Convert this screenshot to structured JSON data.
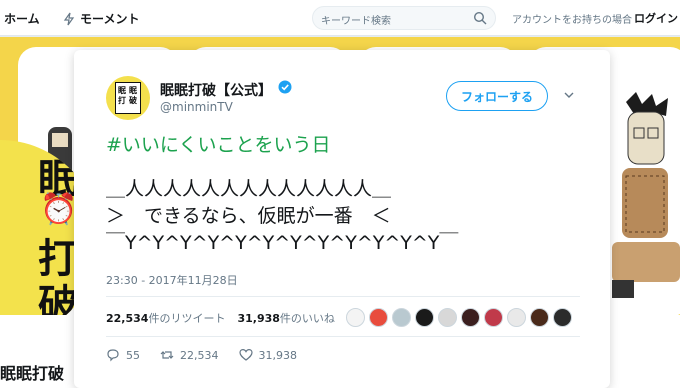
{
  "nav": {
    "home": "ホーム",
    "moments": "モーメント",
    "search_placeholder": "キーワード検索",
    "account_prompt": "アカウントをお持ちの場合",
    "login": "ログイン"
  },
  "background": {
    "banner_color": "#f4d54a",
    "avatar_chars": [
      "眠",
      "⏰",
      "打",
      "破"
    ],
    "profile_name": "眠眠打破【公"
  },
  "tweet": {
    "display_name": "眠眠打破【公式】",
    "screen_name": "@minminTV",
    "verified": true,
    "follow_label": "フォローする",
    "hashtag": "#いいにくいことをいう日",
    "ascii_art": [
      "＿人人人人人人人人人人人人人＿",
      "＞　できるなら、仮眠が一番　＜",
      "￣Y^Y^Y^Y^Y^Y^Y^Y^Y^Y^Y^Y￣"
    ],
    "timestamp": "23:30 - 2017年11月28日",
    "retweet_count": "22,534",
    "retweet_label": "件のリツイート",
    "like_count": "31,938",
    "like_label": "件のいいね",
    "actions": {
      "reply_count": "55",
      "retweet_count": "22,534",
      "like_count": "31,938"
    },
    "liker_avatar_colors": [
      "#f4f4f4",
      "#e84c3d",
      "#b9c9d0",
      "#1a1a1a",
      "#d8d8d8",
      "#3b1f1f",
      "#c03a4a",
      "#e9e9e9",
      "#4a2a1a",
      "#2b2b2b"
    ],
    "accent_color": "#1da1f2",
    "hashtag_color": "#1ca24e"
  }
}
